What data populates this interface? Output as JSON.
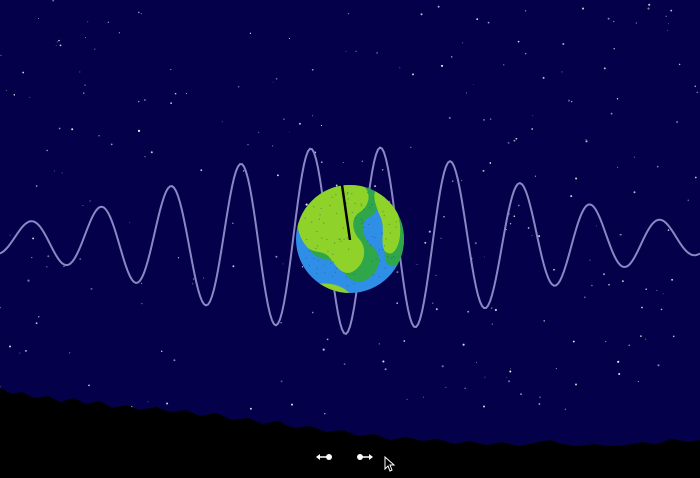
{
  "scene": {
    "name": "earth-wave-animation",
    "colors": {
      "sky": "#05004a",
      "wave": "#8a88c4",
      "ocean": "#2f8fe6",
      "land": "#8fd22a",
      "land_shade": "#2fa64a",
      "ground": "#000000",
      "star": "#ffffff"
    }
  },
  "controls": {
    "left_icon": "arrow-left-dot-icon",
    "right_icon": "arrow-right-dot-icon",
    "cursor_icon": "mouse-pointer-icon"
  }
}
